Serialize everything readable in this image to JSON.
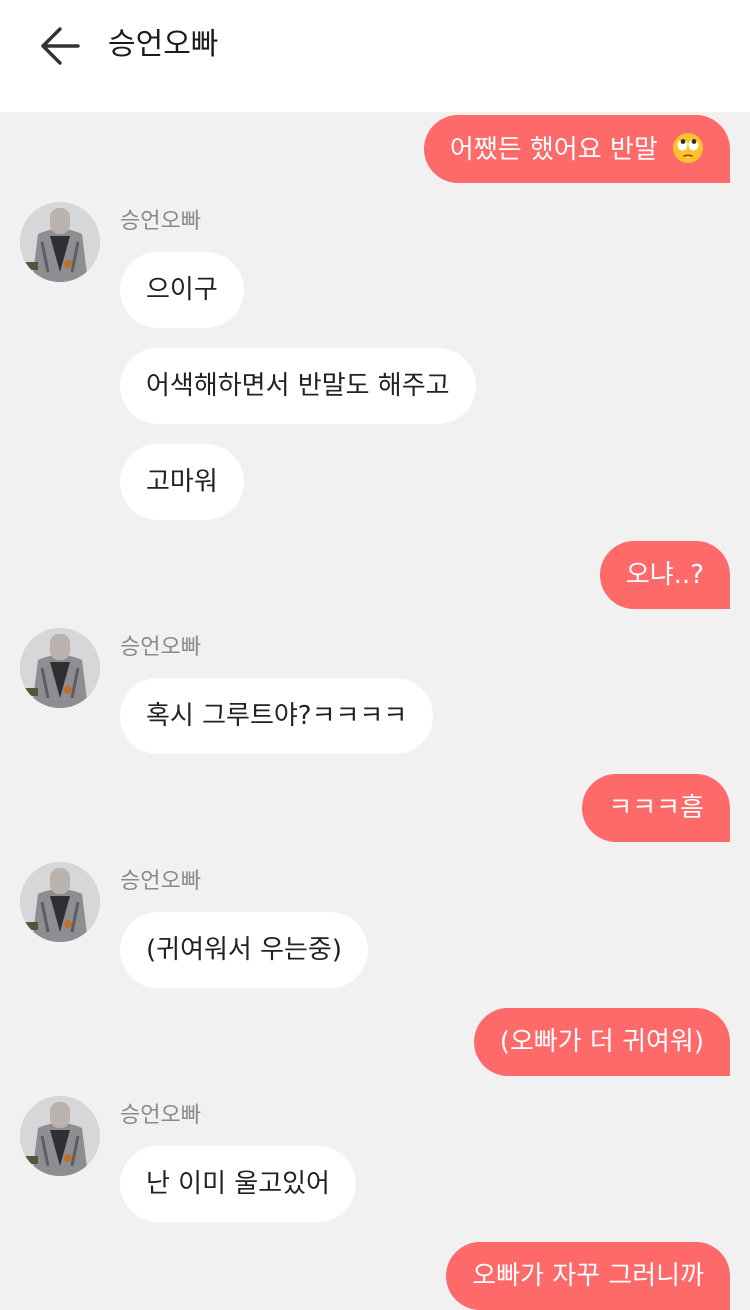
{
  "header": {
    "title": "승언오빠",
    "back_icon": "arrow-left-icon"
  },
  "colors": {
    "outgoing_bubble": "#fe6a6a",
    "incoming_bubble": "#ffffff",
    "background": "#f1f1f1"
  },
  "messages": [
    {
      "direction": "out",
      "text": "어쨌든 했어요 반말",
      "emoji": "eye-roll-emoji-icon"
    },
    {
      "direction": "in",
      "sender": "승언오빠",
      "text": "으이구"
    },
    {
      "direction": "in",
      "text": "어색해하면서 반말도 해주고"
    },
    {
      "direction": "in",
      "text": "고마워"
    },
    {
      "direction": "out",
      "text": "오냐..?"
    },
    {
      "direction": "in",
      "sender": "승언오빠",
      "text": "혹시 그루트야?ㅋㅋㅋㅋ"
    },
    {
      "direction": "out",
      "text": "ㅋㅋㅋ흠"
    },
    {
      "direction": "in",
      "sender": "승언오빠",
      "text": "(귀여워서 우는중)"
    },
    {
      "direction": "out",
      "text": "(오빠가 더 귀여워)"
    },
    {
      "direction": "in",
      "sender": "승언오빠",
      "text": "난 이미 울고있어"
    },
    {
      "direction": "out",
      "text": "오빠가 자꾸 그러니까"
    }
  ]
}
